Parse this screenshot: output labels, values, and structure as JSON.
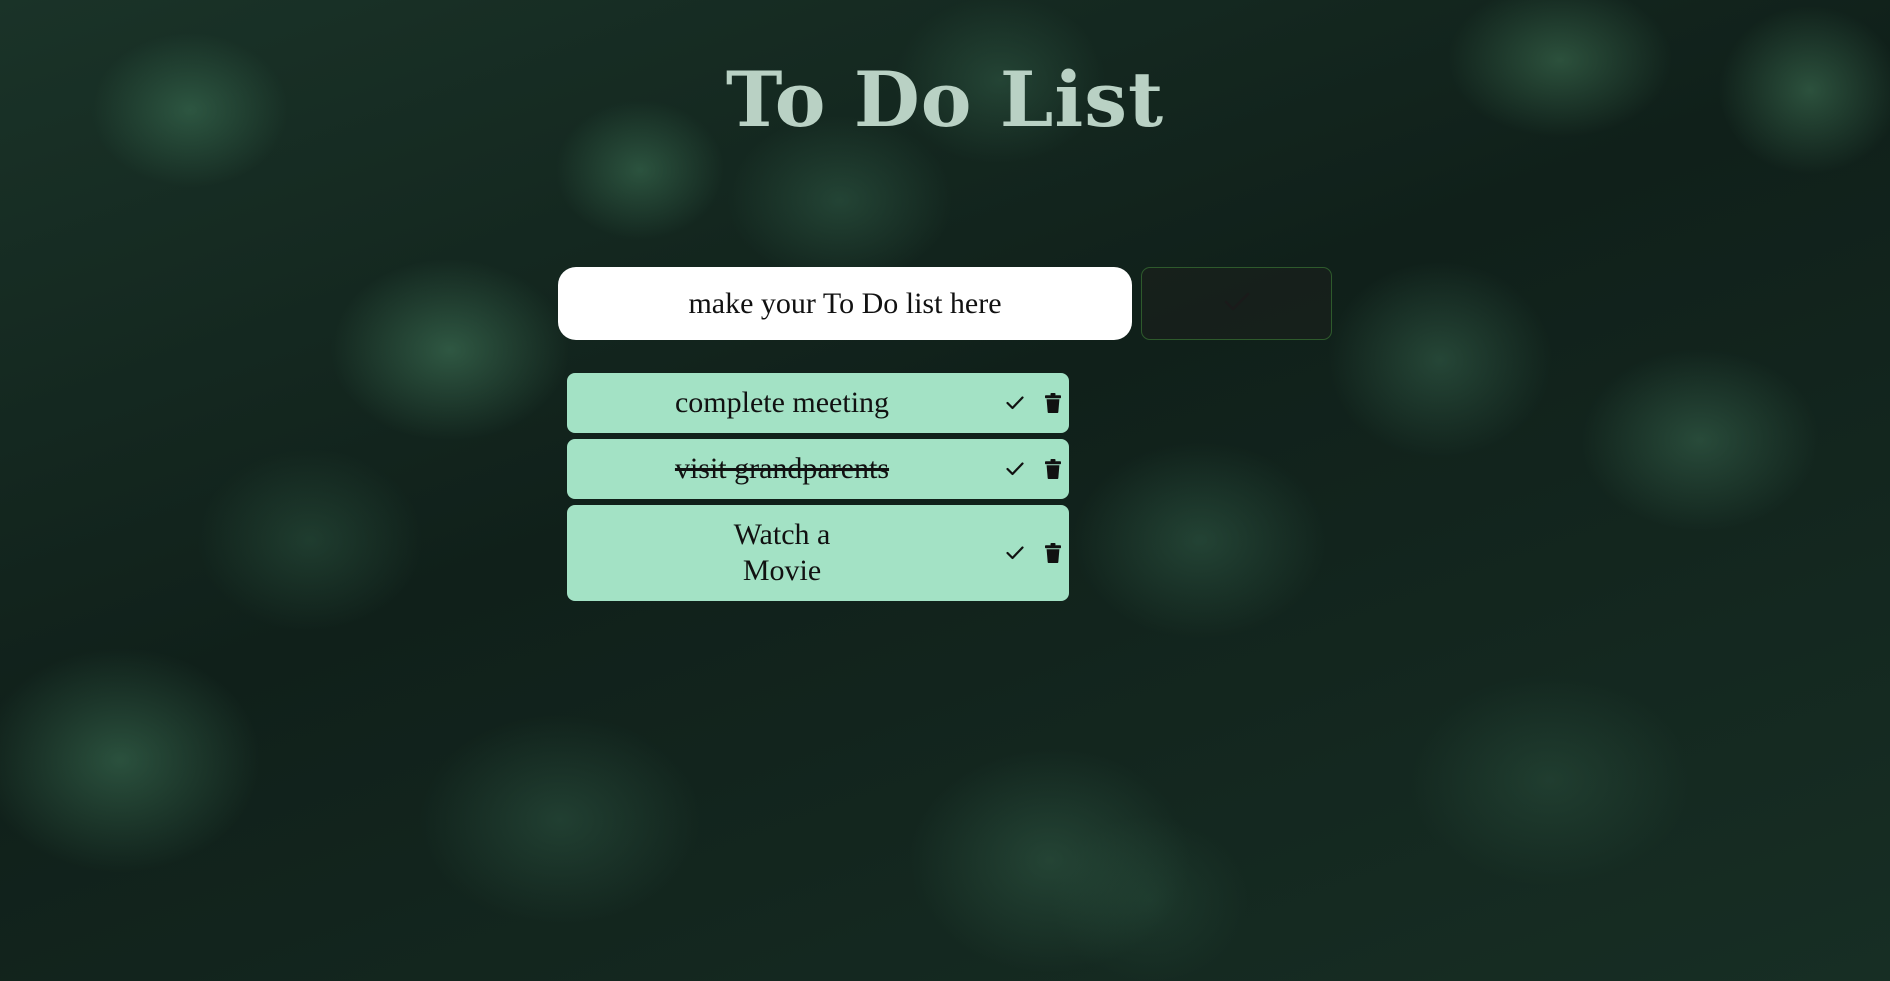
{
  "page": {
    "title": "To Do List"
  },
  "input": {
    "placeholder": "make your To Do list here"
  },
  "add_button": {
    "icon": "check-icon"
  },
  "todos": [
    {
      "text": "complete meeting",
      "completed": false
    },
    {
      "text": "visit grandparents",
      "completed": true
    },
    {
      "text": "Watch a Movie",
      "completed": false
    }
  ],
  "colors": {
    "title": "#b9d1c4",
    "item_bg": "#a3e2c5",
    "input_bg": "#ffffff",
    "add_button_border": "#2e5a2c"
  }
}
